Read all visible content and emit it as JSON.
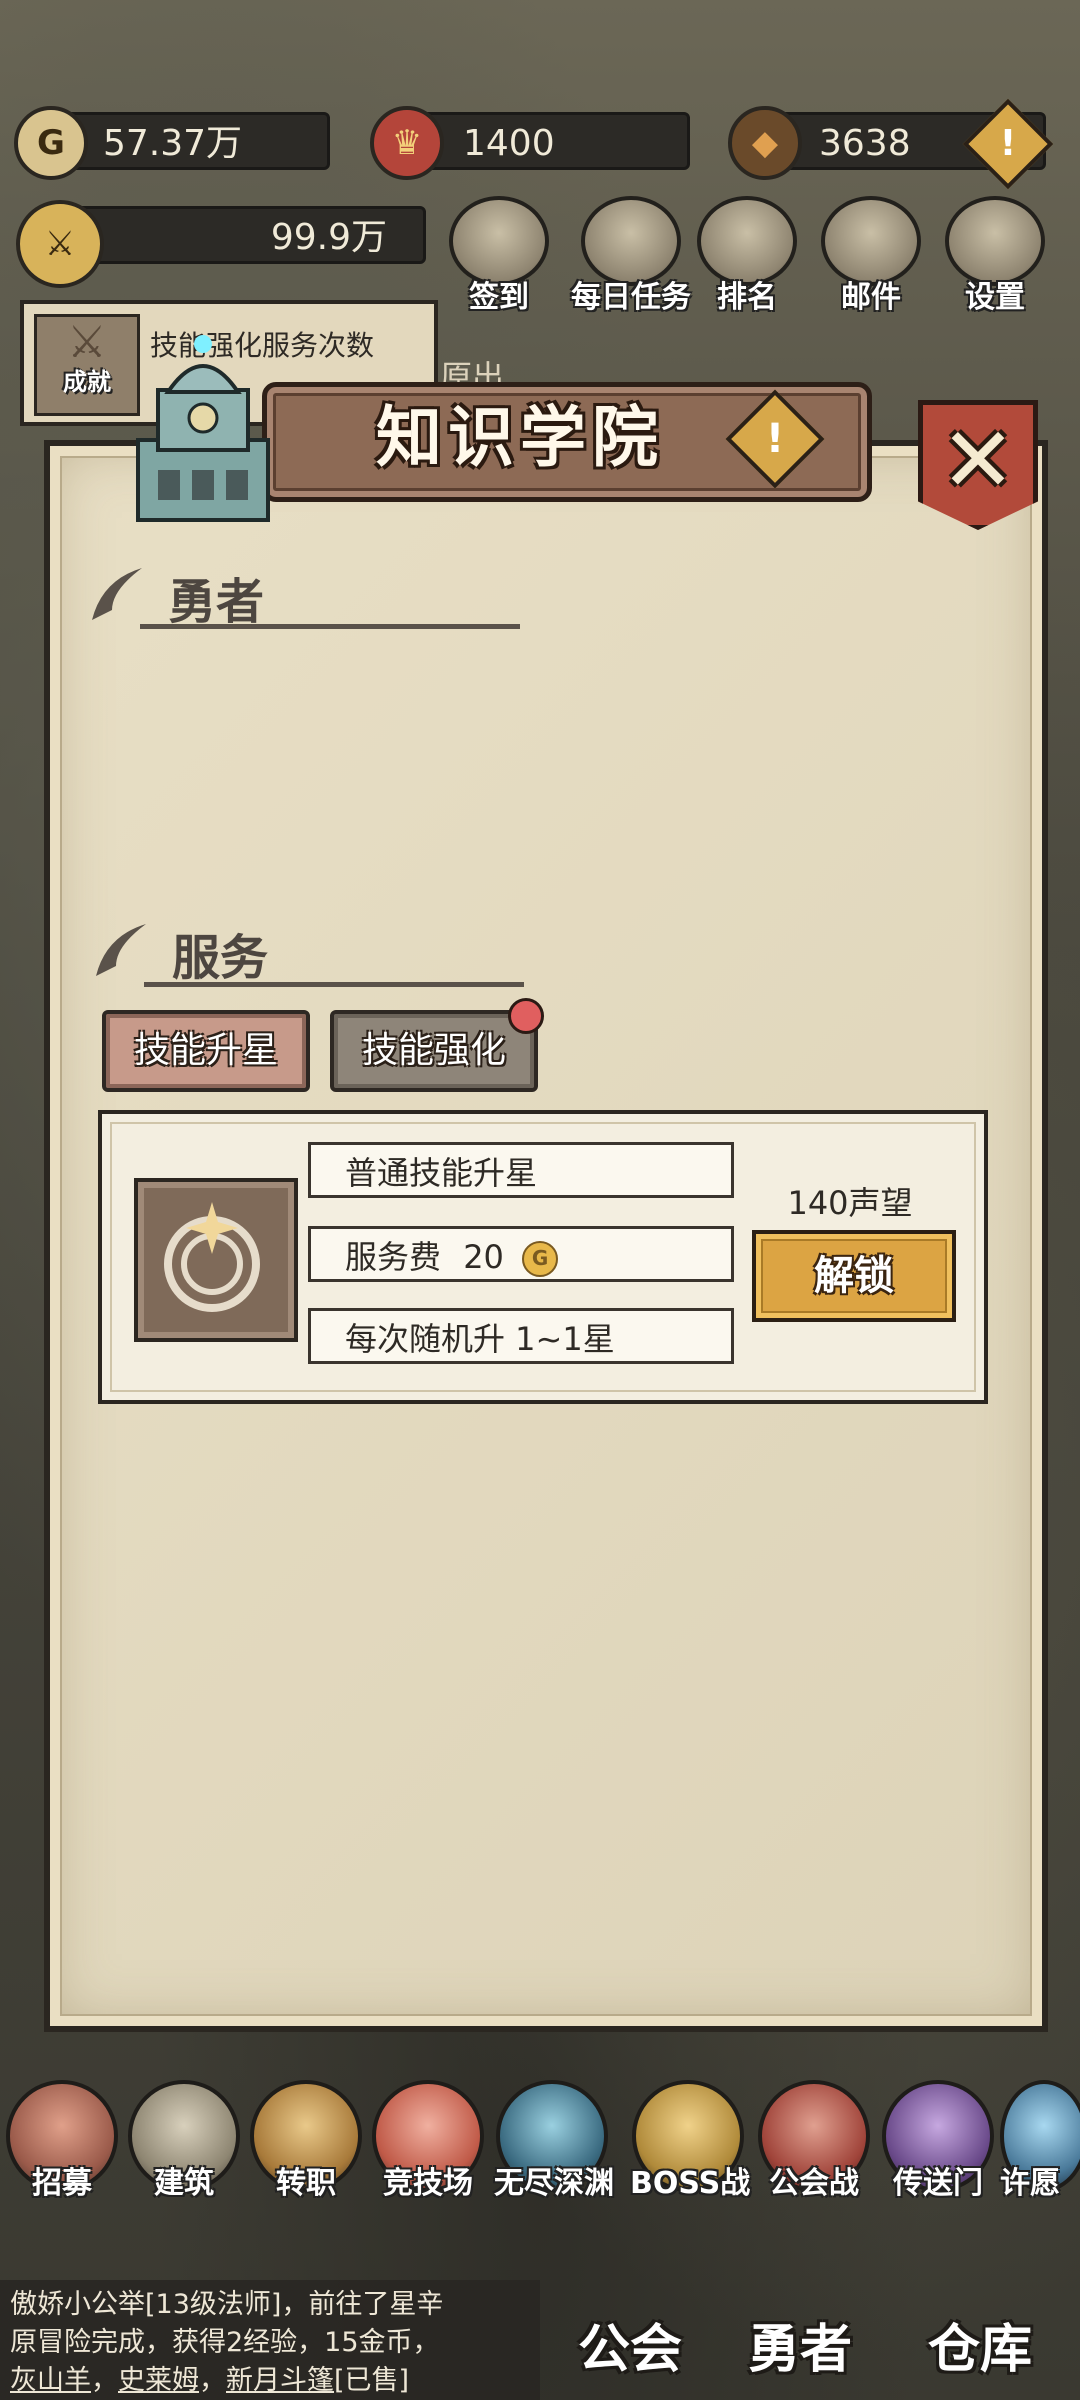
{
  "resources": {
    "gold": "57.37万",
    "honor": "1400",
    "energy": "3638",
    "power": "99.9万"
  },
  "top_menu": [
    {
      "label": "签到",
      "icon": "quill-icon"
    },
    {
      "label": "每日任务",
      "icon": "scroll-icon"
    },
    {
      "label": "排名",
      "icon": "crown-icon"
    },
    {
      "label": "邮件",
      "icon": "mail-icon"
    },
    {
      "label": "设置",
      "icon": "gear-icon"
    }
  ],
  "quest": {
    "text": "技能强化服务次数",
    "achievement_label": "成就",
    "hint": "原出"
  },
  "panel": {
    "title": "知识学院",
    "warn_mark": "!",
    "close_mark": "✕",
    "section_hero": "勇者",
    "section_service": "服务",
    "tabs": [
      {
        "label": "技能升星",
        "active": true
      },
      {
        "label": "技能强化",
        "active": false,
        "badge": true
      }
    ],
    "card": {
      "name": "普通技能升星",
      "fee_label": "服务费",
      "fee_value": "20",
      "coin_mark": "G",
      "effect": "每次随机升 1~1星",
      "cost": "140声望",
      "unlock_label": "解锁"
    }
  },
  "bottom_menu": [
    {
      "label": "招募"
    },
    {
      "label": "建筑"
    },
    {
      "label": "转职"
    },
    {
      "label": "竞技场"
    },
    {
      "label": "无尽深渊"
    },
    {
      "label": "BOSS战"
    },
    {
      "label": "公会战"
    },
    {
      "label": "传送门"
    },
    {
      "label": "许愿"
    }
  ],
  "chat": {
    "line1": "傲娇小公举[13级法师]，前往了星辛",
    "line2": "原冒险完成，获得2经验，15金币，",
    "loot1": "灰山羊",
    "loot2": "史莱姆",
    "loot3": "新月斗篷",
    "sold": "[已售]",
    "sep": "，"
  },
  "main_tabs": {
    "guild": "公会",
    "hero": "勇者",
    "warehouse": "仓库"
  },
  "colors": {
    "panel_bg": "#e6dcc0",
    "title_banner": "#8d6a55",
    "close_red": "#b24a3a",
    "unlock_gold": "#dca443",
    "tab_active": "#c79a8a",
    "tab_inactive": "#8e8579",
    "badge_red": "#e05f5f"
  }
}
